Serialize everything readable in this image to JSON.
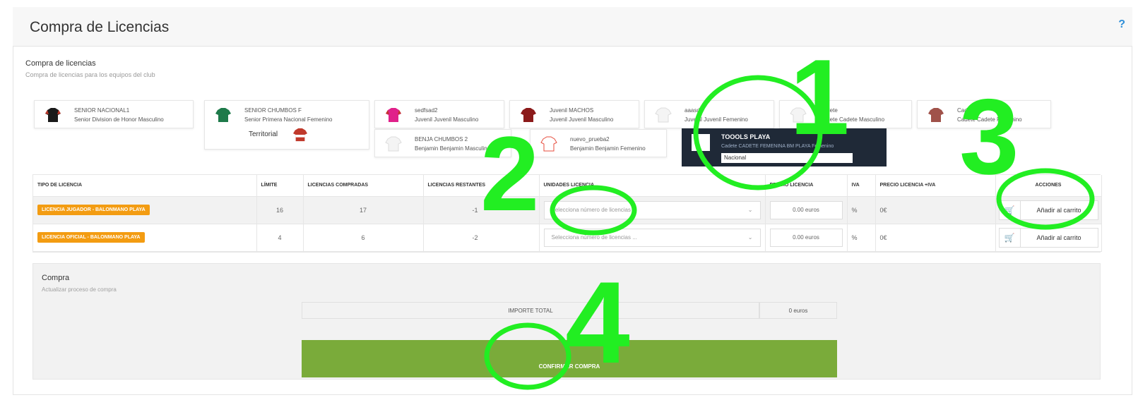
{
  "header": {
    "title": "Compra de Licencias",
    "help": "?"
  },
  "section": {
    "title": "Compra de licencias",
    "subtitle": "Compra de licencias para los equipos del club"
  },
  "teams": [
    {
      "name": "SENIOR NACIONAL1",
      "category": "Senior Division de Honor Masculino",
      "shirt_color": "#1a1a1a",
      "sleeve_color": "#c0392b"
    },
    {
      "name": "SENIOR CHUMBOS F",
      "category": "Senior Primera Nacional Femenino",
      "shirt_color": "#1e7a4a",
      "sleeve_color": "#1e7a4a"
    },
    {
      "name": "sedfsad2",
      "category": "Juvenil Juvenil Masculino",
      "shirt_color": "#e0218a",
      "sleeve_color": "#c0392b"
    },
    {
      "name": "Juvenil MACHOS",
      "category": "Juvenil Juvenil Masculino",
      "shirt_color": "#8b1a1a",
      "sleeve_color": "#8b1a1a"
    },
    {
      "name": "aaasd",
      "category": "Juvenil Juvenil Femenino",
      "shirt_color": "#f4f4f4",
      "sleeve_color": "#dddddd"
    },
    {
      "name": "Cadete",
      "category": "Cadete Cadete Masculino",
      "shirt_color": "#f4f4f4",
      "sleeve_color": "#dddddd"
    },
    {
      "name": "Cadete",
      "category": "Cadete Cadete Femenino",
      "shirt_color": "#a0524a",
      "sleeve_color": "#7a3a34"
    },
    {
      "name": "BENJA CHUMBOS 2",
      "category": "Benjamin Benjamin Masculino",
      "shirt_color": "#f4f4f4",
      "sleeve_color": "#dddddd"
    },
    {
      "name": "nuevo_prueba2",
      "category": "Benjamin Benjamin Femenino",
      "shirt_color": "#ffffff",
      "sleeve_color": "#e74c3c"
    }
  ],
  "territorial_label": "Territorial",
  "dropdown_popup": {
    "title": "TOOOLS PLAYA",
    "subtitle": "Cadete CADETE FEMENINA BM PLAYA Femenino",
    "selected_option": "Nacional"
  },
  "table": {
    "headers": [
      "TIPO DE LICENCIA",
      "LÍMITE",
      "LICENCIAS COMPRADAS",
      "LICENCIAS RESTANTES",
      "UNIDADES LICENCIA",
      "PRECIO LICENCIA",
      "IVA",
      "PRECIO LICENCIA +IVA",
      "ACCIONES"
    ],
    "rows": [
      {
        "type": "LICENCIA JUGADOR - BALONMANO PLAYA",
        "limit": "16",
        "bought": "17",
        "remaining": "-1",
        "units_placeholder": "Selecciona número de licencias ...",
        "price": "0.00 euros",
        "iva": "%",
        "price_iva": "0€",
        "action": "Añadir al carrito"
      },
      {
        "type": "LICENCIA OFICIAL - BALONMANO PLAYA",
        "limit": "4",
        "bought": "6",
        "remaining": "-2",
        "units_placeholder": "Selecciona número de licencias ...",
        "price": "0.00 euros",
        "iva": "%",
        "price_iva": "0€",
        "action": "Añadir al carrito"
      }
    ]
  },
  "purchase": {
    "title": "Compra",
    "subtitle": "Actualizar proceso de compra",
    "total_label": "IMPORTE TOTAL",
    "total_value": "0 euros",
    "confirm_label": "CONFIRMAR COMPRA"
  },
  "annotations": {
    "n1": "1",
    "n2": "2",
    "n3": "3",
    "n4": "4",
    "color": "#22ee22"
  },
  "colors": {
    "badge": "#f39c12",
    "confirm": "#7aab3a",
    "popup": "#1f2937",
    "help": "#2f8fd8"
  },
  "icons": {
    "help": "question-icon",
    "cart": "cart-icon",
    "chevron": "chevron-down-icon",
    "shirt": "shirt-icon"
  }
}
